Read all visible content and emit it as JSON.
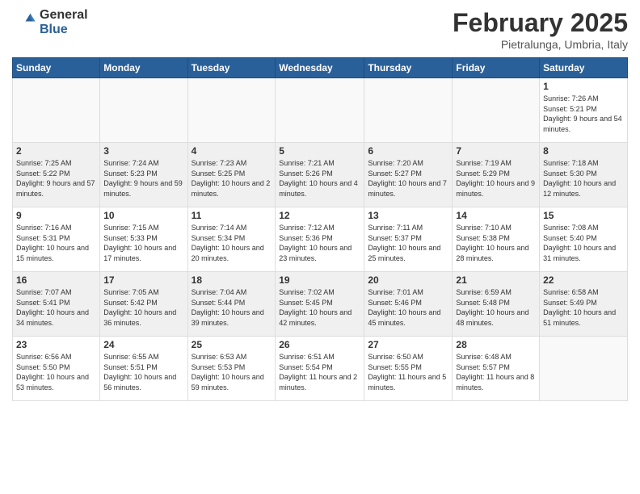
{
  "logo": {
    "general": "General",
    "blue": "Blue"
  },
  "title": "February 2025",
  "subtitle": "Pietralunga, Umbria, Italy",
  "headers": [
    "Sunday",
    "Monday",
    "Tuesday",
    "Wednesday",
    "Thursday",
    "Friday",
    "Saturday"
  ],
  "weeks": [
    {
      "shaded": false,
      "days": [
        {
          "num": "",
          "info": ""
        },
        {
          "num": "",
          "info": ""
        },
        {
          "num": "",
          "info": ""
        },
        {
          "num": "",
          "info": ""
        },
        {
          "num": "",
          "info": ""
        },
        {
          "num": "",
          "info": ""
        },
        {
          "num": "1",
          "info": "Sunrise: 7:26 AM\nSunset: 5:21 PM\nDaylight: 9 hours\nand 54 minutes."
        }
      ]
    },
    {
      "shaded": true,
      "days": [
        {
          "num": "2",
          "info": "Sunrise: 7:25 AM\nSunset: 5:22 PM\nDaylight: 9 hours\nand 57 minutes."
        },
        {
          "num": "3",
          "info": "Sunrise: 7:24 AM\nSunset: 5:23 PM\nDaylight: 9 hours\nand 59 minutes."
        },
        {
          "num": "4",
          "info": "Sunrise: 7:23 AM\nSunset: 5:25 PM\nDaylight: 10 hours\nand 2 minutes."
        },
        {
          "num": "5",
          "info": "Sunrise: 7:21 AM\nSunset: 5:26 PM\nDaylight: 10 hours\nand 4 minutes."
        },
        {
          "num": "6",
          "info": "Sunrise: 7:20 AM\nSunset: 5:27 PM\nDaylight: 10 hours\nand 7 minutes."
        },
        {
          "num": "7",
          "info": "Sunrise: 7:19 AM\nSunset: 5:29 PM\nDaylight: 10 hours\nand 9 minutes."
        },
        {
          "num": "8",
          "info": "Sunrise: 7:18 AM\nSunset: 5:30 PM\nDaylight: 10 hours\nand 12 minutes."
        }
      ]
    },
    {
      "shaded": false,
      "days": [
        {
          "num": "9",
          "info": "Sunrise: 7:16 AM\nSunset: 5:31 PM\nDaylight: 10 hours\nand 15 minutes."
        },
        {
          "num": "10",
          "info": "Sunrise: 7:15 AM\nSunset: 5:33 PM\nDaylight: 10 hours\nand 17 minutes."
        },
        {
          "num": "11",
          "info": "Sunrise: 7:14 AM\nSunset: 5:34 PM\nDaylight: 10 hours\nand 20 minutes."
        },
        {
          "num": "12",
          "info": "Sunrise: 7:12 AM\nSunset: 5:36 PM\nDaylight: 10 hours\nand 23 minutes."
        },
        {
          "num": "13",
          "info": "Sunrise: 7:11 AM\nSunset: 5:37 PM\nDaylight: 10 hours\nand 25 minutes."
        },
        {
          "num": "14",
          "info": "Sunrise: 7:10 AM\nSunset: 5:38 PM\nDaylight: 10 hours\nand 28 minutes."
        },
        {
          "num": "15",
          "info": "Sunrise: 7:08 AM\nSunset: 5:40 PM\nDaylight: 10 hours\nand 31 minutes."
        }
      ]
    },
    {
      "shaded": true,
      "days": [
        {
          "num": "16",
          "info": "Sunrise: 7:07 AM\nSunset: 5:41 PM\nDaylight: 10 hours\nand 34 minutes."
        },
        {
          "num": "17",
          "info": "Sunrise: 7:05 AM\nSunset: 5:42 PM\nDaylight: 10 hours\nand 36 minutes."
        },
        {
          "num": "18",
          "info": "Sunrise: 7:04 AM\nSunset: 5:44 PM\nDaylight: 10 hours\nand 39 minutes."
        },
        {
          "num": "19",
          "info": "Sunrise: 7:02 AM\nSunset: 5:45 PM\nDaylight: 10 hours\nand 42 minutes."
        },
        {
          "num": "20",
          "info": "Sunrise: 7:01 AM\nSunset: 5:46 PM\nDaylight: 10 hours\nand 45 minutes."
        },
        {
          "num": "21",
          "info": "Sunrise: 6:59 AM\nSunset: 5:48 PM\nDaylight: 10 hours\nand 48 minutes."
        },
        {
          "num": "22",
          "info": "Sunrise: 6:58 AM\nSunset: 5:49 PM\nDaylight: 10 hours\nand 51 minutes."
        }
      ]
    },
    {
      "shaded": false,
      "days": [
        {
          "num": "23",
          "info": "Sunrise: 6:56 AM\nSunset: 5:50 PM\nDaylight: 10 hours\nand 53 minutes."
        },
        {
          "num": "24",
          "info": "Sunrise: 6:55 AM\nSunset: 5:51 PM\nDaylight: 10 hours\nand 56 minutes."
        },
        {
          "num": "25",
          "info": "Sunrise: 6:53 AM\nSunset: 5:53 PM\nDaylight: 10 hours\nand 59 minutes."
        },
        {
          "num": "26",
          "info": "Sunrise: 6:51 AM\nSunset: 5:54 PM\nDaylight: 11 hours\nand 2 minutes."
        },
        {
          "num": "27",
          "info": "Sunrise: 6:50 AM\nSunset: 5:55 PM\nDaylight: 11 hours\nand 5 minutes."
        },
        {
          "num": "28",
          "info": "Sunrise: 6:48 AM\nSunset: 5:57 PM\nDaylight: 11 hours\nand 8 minutes."
        },
        {
          "num": "",
          "info": ""
        }
      ]
    }
  ]
}
